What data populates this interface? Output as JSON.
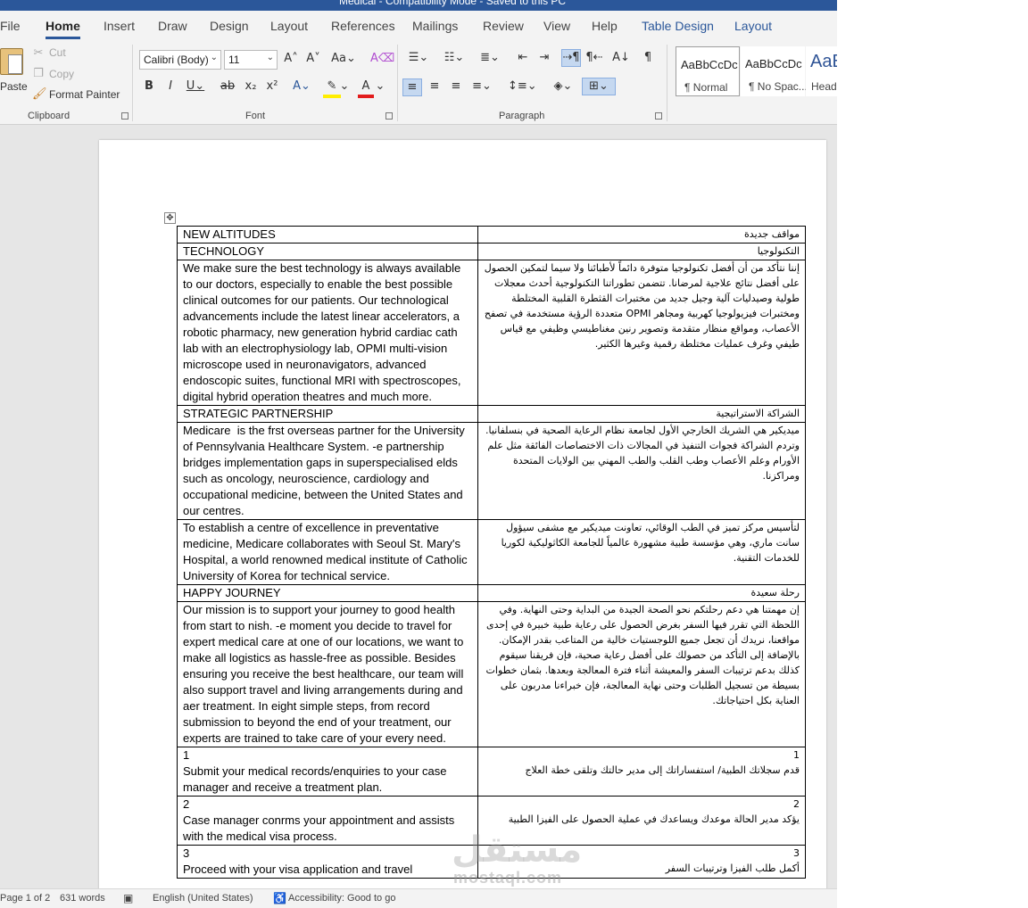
{
  "title_bar": {
    "text": "Medical  -  Compatibility Mode  -  Saved to this PC"
  },
  "ribbon_tabs": [
    "File",
    "Home",
    "Insert",
    "Draw",
    "Design",
    "Layout",
    "References",
    "Mailings",
    "Review",
    "View",
    "Help",
    "Table Design",
    "Layout"
  ],
  "active_tab": "Home",
  "clipboard": {
    "paste": "Paste",
    "cut": "Cut",
    "copy": "Copy",
    "format_painter": "Format Painter",
    "group": "Clipboard"
  },
  "font": {
    "name": "Calibri (Body)",
    "size": "11",
    "group": "Font"
  },
  "paragraph": {
    "group": "Paragraph"
  },
  "styles": [
    {
      "preview": "AaBbCcDc",
      "name": "¶ Normal"
    },
    {
      "preview": "AaBbCcDc",
      "name": "¶ No Spac..."
    },
    {
      "preview": "AaB",
      "name": "Head"
    }
  ],
  "document_rows": [
    {
      "en": "NEW ALTITUDES",
      "ar": "مواقف جديدة"
    },
    {
      "en": "TECHNOLOGY",
      "ar": "التكنولوجيا"
    },
    {
      "en": "We make sure the best technology is always available to our doctors, especially to enable the best possible clinical outcomes for our patients. Our technological advancements include the latest linear accelerators, a robotic pharmacy, new generation hybrid cardiac cath lab with an electrophysiology lab, OPMI multi-vision microscope used in neuronavigators, advanced endoscopic suites, functional MRI with spectroscopes, digital hybrid operation theatres and much more.",
      "ar": "إننا نتأكد من أن أفضل تكنولوجيا متوفرة دائماً لأطبائنا ولا سيما لتمكين الحصول على أفضل نتائج علاجية لمرضانا. تتضمن تطوراتنا التكنولوجية أحدث معجلات طولية وصيدليات آلية وجيل جديد من مختبرات القثطرة القلبية المختلطة ومختبرات فيزيولوجيا كهربية ومجاهر OPMI متعددة الرؤية مستخدمة في تصفح الأعصاب، ومواقع منظار متقدمة وتصوير رنين مغناطيسي وظيفي مع قياس طيفي وغرف عمليات مختلطة رقمية وغيرها الكثير."
    },
    {
      "en": "STRATEGIC PARTNERSHIP",
      "ar": "الشراكة الاستراتيجية"
    },
    {
      "en": "Medicare  is the frst overseas partner for the University of Pennsylvania Healthcare System. -e partnership bridges implementation gaps in superspecialised elds such as oncology, neuroscience, cardiology and occupational medicine, between the United States and our centres.",
      "ar": "ميديكير هي الشريك الخارجي الأول لجامعة نظام الرعاية الصحية في بنسلفانيا. وتردم الشراكة فجوات التنفيذ في المجالات ذات الاختصاصات الفائقة مثل علم الأورام وعلم الأعصاب وطب القلب والطب المهني بين الولايات المتحدة ومراكزنا."
    },
    {
      "en": "To establish a centre of excellence in preventative medicine, Medicare collaborates with Seoul St. Mary's Hospital, a world renowned medical institute of Catholic University of Korea for technical service.",
      "ar": "لتأسيس مركز تميز في الطب الوقائي، تعاونت ميديكير مع مشفى سيؤول سانت ماري، وهي مؤسسة طبية مشهورة عالمياً للجامعة الكاثوليكية لكوريا للخدمات التقنية."
    },
    {
      "en": "HAPPY JOURNEY",
      "ar": "رحلة سعيدة"
    },
    {
      "en": "Our mission is to support your journey to good health from start to nish. -e moment you decide to travel for expert medical care at one of our locations, we want to make all logistics as hassle-free as possible. Besides ensuring you receive the best healthcare, our team will also support travel and living arrangements during and aer treatment. In eight simple steps, from record submission to beyond the end of your treatment, our experts are trained to take care of your every need.",
      "ar": "إن مهمتنا هي دعم رحلتكم نحو الصحة الجيدة من البداية وحتى النهاية. وفي اللحظة التي تقرر فيها السفر بغرض الحصول على رعاية طبية خبيرة في إحدى مواقعنا، نريدك أن تجعل جميع اللوجستيات خالية من المتاعب بقدر الإمكان. بالإضافة إلى التأكد من حصولك على أفضل رعاية صحية، فإن فريقنا سيقوم كذلك بدعم ترتيبات السفر والمعيشة أثناء فترة المعالجة وبعدها. بثمان خطوات بسيطة من تسجيل الطلبات وحتى نهاية المعالجة، فإن خبراءنا مدربون على العناية بكل احتياجاتك."
    },
    {
      "en": "1\nSubmit your medical records/enquiries to your case manager and receive a treatment plan.",
      "ar": "1\nقدم سجلاتك الطبية/ استفساراتك إلى مدير حالتك وتلقى خطة العلاج"
    },
    {
      "en": "2\nCase manager conrms your appointment and assists with the medical visa process.",
      "ar": "2\nيؤكد مدير الحالة موعدك ويساعدك في عملية الحصول على الفيزا الطبية"
    },
    {
      "en": "3\nProceed with your visa application and travel",
      "ar": "3\nأكمل طلب الفيزا وترتيبات السفر"
    }
  ],
  "status_bar": {
    "page": "Page 1 of 2",
    "words": "631 words",
    "language": "English (United States)",
    "accessibility": "Accessibility: Good to go"
  },
  "watermark": {
    "arabic": "مستقل",
    "latin": "mostaql.com"
  }
}
